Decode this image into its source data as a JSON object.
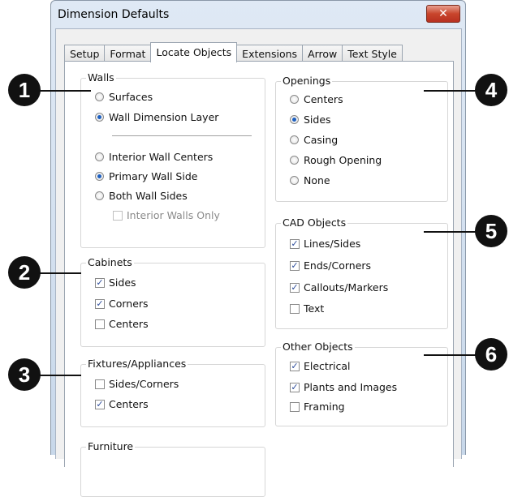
{
  "window": {
    "title": "Dimension Defaults",
    "close_glyph": "✕"
  },
  "tabs": [
    {
      "label": "Setup",
      "active": false
    },
    {
      "label": "Format",
      "active": false
    },
    {
      "label": "Locate Objects",
      "active": true
    },
    {
      "label": "Extensions",
      "active": false
    },
    {
      "label": "Arrow",
      "active": false
    },
    {
      "label": "Text Style",
      "active": false
    }
  ],
  "walls": {
    "title": "Walls",
    "surfaces": {
      "label": "Surfaces",
      "checked": false
    },
    "wall_dimension_layer": {
      "label": "Wall Dimension Layer",
      "checked": true
    },
    "interior_wall_centers": {
      "label": "Interior Wall Centers",
      "checked": false
    },
    "primary_wall_side": {
      "label": "Primary Wall Side",
      "checked": true
    },
    "both_wall_sides": {
      "label": "Both Wall Sides",
      "checked": false
    },
    "interior_walls_only": {
      "label": "Interior Walls Only",
      "checked": false,
      "enabled": false
    }
  },
  "cabinets": {
    "title": "Cabinets",
    "sides": {
      "label": "Sides",
      "checked": true
    },
    "corners": {
      "label": "Corners",
      "checked": true
    },
    "centers": {
      "label": "Centers",
      "checked": false
    }
  },
  "fixtures": {
    "title": "Fixtures/Appliances",
    "sides_corners": {
      "label": "Sides/Corners",
      "checked": false
    },
    "centers": {
      "label": "Centers",
      "checked": true
    }
  },
  "furniture": {
    "title": "Furniture"
  },
  "openings": {
    "title": "Openings",
    "centers": {
      "label": "Centers",
      "checked": false
    },
    "sides": {
      "label": "Sides",
      "checked": true
    },
    "casing": {
      "label": "Casing",
      "checked": false
    },
    "rough_opening": {
      "label": "Rough Opening",
      "checked": false
    },
    "none": {
      "label": "None",
      "checked": false
    }
  },
  "cad_objects": {
    "title": "CAD Objects",
    "lines_sides": {
      "label": "Lines/Sides",
      "checked": true
    },
    "ends_corners": {
      "label": "Ends/Corners",
      "checked": true
    },
    "callouts_markers": {
      "label": "Callouts/Markers",
      "checked": true
    },
    "text": {
      "label": "Text",
      "checked": false
    }
  },
  "other_objects": {
    "title": "Other Objects",
    "electrical": {
      "label": "Electrical",
      "checked": true
    },
    "plants_images": {
      "label": "Plants and Images",
      "checked": true
    },
    "framing": {
      "label": "Framing",
      "checked": false
    }
  },
  "callouts": [
    "1",
    "2",
    "3",
    "4",
    "5",
    "6"
  ],
  "checkmark": "✓"
}
